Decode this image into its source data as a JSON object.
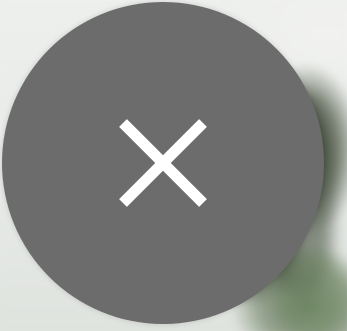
{
  "close_button": {
    "icon": "close-icon",
    "color": "#6c6c6c",
    "icon_color": "#ffffff"
  }
}
